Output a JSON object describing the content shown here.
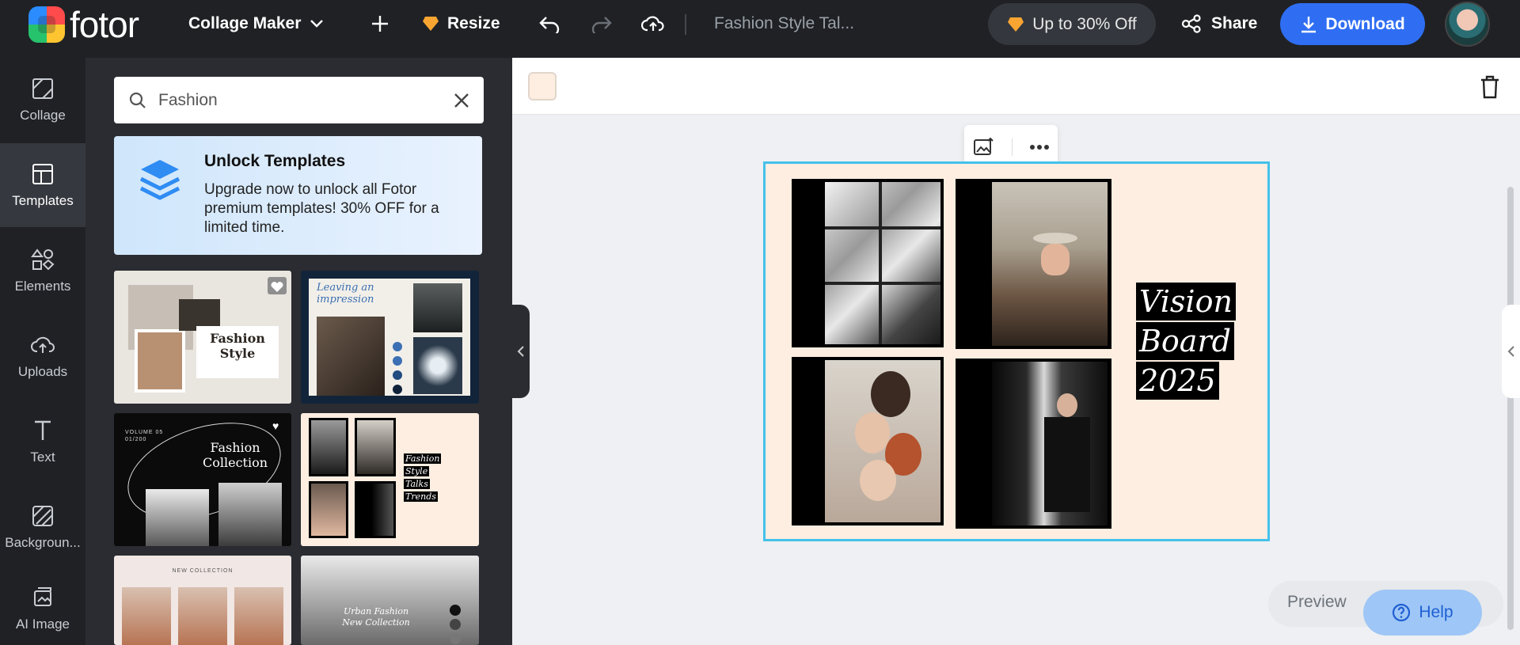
{
  "app": {
    "logo_text": "fotor",
    "mode_label": "Collage Maker",
    "resize_label": "Resize",
    "project_title": "Fashion Style Tal...",
    "offer_label": "Up to 30% Off",
    "share_label": "Share",
    "download_label": "Download"
  },
  "sidebar": {
    "items": [
      {
        "label": "Collage",
        "icon": "collage-icon"
      },
      {
        "label": "Templates",
        "icon": "templates-icon"
      },
      {
        "label": "Elements",
        "icon": "elements-icon"
      },
      {
        "label": "Uploads",
        "icon": "uploads-icon"
      },
      {
        "label": "Text",
        "icon": "text-icon"
      },
      {
        "label": "Backgroun...",
        "icon": "background-icon"
      },
      {
        "label": "AI Image",
        "icon": "ai-image-icon"
      }
    ]
  },
  "panel": {
    "search_value": "Fashion",
    "unlock_title": "Unlock Templates",
    "unlock_text": "Upgrade now to unlock all Fotor premium templates! 30% OFF for a limited time.",
    "templates": [
      {
        "title_lines": [
          "Fashion",
          "Style"
        ]
      },
      {
        "title_lines": [
          "Leaving an",
          "impression"
        ]
      },
      {
        "title_lines": [
          "Fashion",
          "Collection"
        ],
        "small": "VOLUME 05\n01/200"
      },
      {
        "title_lines": [
          "Fashion",
          "Style",
          "Talks",
          "Trends"
        ]
      },
      {
        "title_lines": [
          "NEW COLLECTION"
        ]
      },
      {
        "title_lines": [
          "Urban Fashion",
          "New Collection"
        ]
      }
    ]
  },
  "canvas": {
    "background_color": "#fdeee1",
    "board_lines": [
      "Vision",
      "Board",
      "2025"
    ]
  },
  "bottom": {
    "preview_label": "Preview",
    "help_label": "Help"
  },
  "colors": {
    "accent": "#2f6ef3",
    "selection": "#45c1ea",
    "topbar": "#1f2125"
  }
}
